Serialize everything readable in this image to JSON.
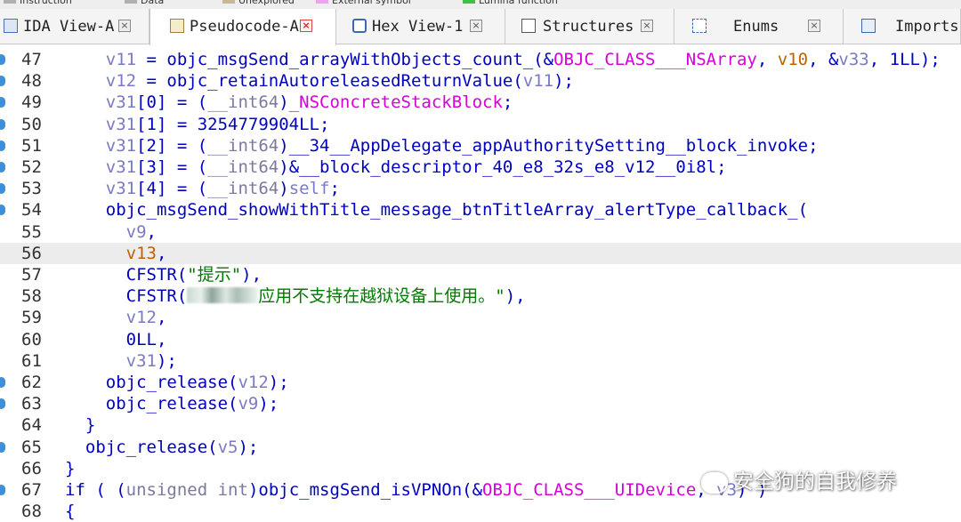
{
  "legend": [
    {
      "label": "Instruction",
      "color": "#b0b0b0"
    },
    {
      "label": "Data",
      "color": "#b0b0b0"
    },
    {
      "label": "Unexplored",
      "color": "#c8b890"
    },
    {
      "label": "External symbol",
      "color": "#f0a0f0"
    },
    {
      "label": "Lumina function",
      "color": "#40c040"
    }
  ],
  "tabs": [
    {
      "label": "IDA View-A",
      "icon": "graph-view-icon",
      "active": false
    },
    {
      "label": "Pseudocode-A",
      "icon": "pseudocode-icon",
      "active": true
    },
    {
      "label": "Hex View-1",
      "icon": "hex-view-icon",
      "active": false
    },
    {
      "label": "Structures",
      "icon": "structures-icon",
      "active": false
    },
    {
      "label": "Enums",
      "icon": "enums-icon",
      "active": false
    },
    {
      "label": "Imports",
      "icon": "imports-icon",
      "active": false
    }
  ],
  "code_lines": [
    {
      "num": "47",
      "bp": true,
      "hl": false,
      "tokens": [
        [
          "pl",
          "    "
        ],
        [
          "var",
          "v11"
        ],
        [
          "pl",
          " = objc_msgSend_arrayWithObjects_count_(&"
        ],
        [
          "mag",
          "OBJC_CLASS___NSArray"
        ],
        [
          "pl",
          ", "
        ],
        [
          "or",
          "v10"
        ],
        [
          "pl",
          ", &"
        ],
        [
          "var",
          "v33"
        ],
        [
          "pl",
          ", 1LL);"
        ]
      ]
    },
    {
      "num": "48",
      "bp": true,
      "hl": false,
      "tokens": [
        [
          "pl",
          "    "
        ],
        [
          "var",
          "v12"
        ],
        [
          "pl",
          " = objc_retainAutoreleasedReturnValue("
        ],
        [
          "var",
          "v11"
        ],
        [
          "pl",
          ");"
        ]
      ]
    },
    {
      "num": "49",
      "bp": true,
      "hl": false,
      "tokens": [
        [
          "pl",
          "    "
        ],
        [
          "var",
          "v31"
        ],
        [
          "pl",
          "[0] = ("
        ],
        [
          "gr",
          "__int64"
        ],
        [
          "pl",
          ")"
        ],
        [
          "mag",
          "_NSConcreteStackBlock"
        ],
        [
          "pl",
          ";"
        ]
      ]
    },
    {
      "num": "50",
      "bp": true,
      "hl": false,
      "tokens": [
        [
          "pl",
          "    "
        ],
        [
          "var",
          "v31"
        ],
        [
          "pl",
          "[1] = 3254779904LL;"
        ]
      ]
    },
    {
      "num": "51",
      "bp": true,
      "hl": false,
      "tokens": [
        [
          "pl",
          "    "
        ],
        [
          "var",
          "v31"
        ],
        [
          "pl",
          "[2] = ("
        ],
        [
          "gr",
          "__int64"
        ],
        [
          "pl",
          ")__34__AppDelegate_appAuthoritySetting__block_invoke;"
        ]
      ]
    },
    {
      "num": "52",
      "bp": true,
      "hl": false,
      "tokens": [
        [
          "pl",
          "    "
        ],
        [
          "var",
          "v31"
        ],
        [
          "pl",
          "[3] = ("
        ],
        [
          "gr",
          "__int64"
        ],
        [
          "pl",
          ")&__block_descriptor_40_e8_32s_e8_v12__0i8l;"
        ]
      ]
    },
    {
      "num": "53",
      "bp": true,
      "hl": false,
      "tokens": [
        [
          "pl",
          "    "
        ],
        [
          "var",
          "v31"
        ],
        [
          "pl",
          "[4] = ("
        ],
        [
          "gr",
          "__int64"
        ],
        [
          "pl",
          ")"
        ],
        [
          "var",
          "self"
        ],
        [
          "pl",
          ";"
        ]
      ]
    },
    {
      "num": "54",
      "bp": true,
      "hl": false,
      "tokens": [
        [
          "pl",
          "    objc_msgSend_showWithTitle_message_btnTitleArray_alertType_callback_("
        ]
      ]
    },
    {
      "num": "55",
      "bp": false,
      "hl": false,
      "tokens": [
        [
          "pl",
          "      "
        ],
        [
          "var",
          "v9"
        ],
        [
          "pl",
          ","
        ]
      ]
    },
    {
      "num": "56",
      "bp": false,
      "hl": true,
      "tokens": [
        [
          "pl",
          "      "
        ],
        [
          "or",
          "v13"
        ],
        [
          "pl",
          ","
        ]
      ]
    },
    {
      "num": "57",
      "bp": false,
      "hl": false,
      "tokens": [
        [
          "pl",
          "      CFSTR("
        ],
        [
          "str",
          "\"提示\""
        ],
        [
          "pl",
          "),"
        ]
      ]
    },
    {
      "num": "58",
      "bp": false,
      "hl": false,
      "tokens": [
        [
          "pl",
          "      CFSTR("
        ],
        [
          "blur",
          ""
        ],
        [
          "str",
          "应用不支持在越狱设备上使用。\""
        ],
        [
          "pl",
          "),"
        ]
      ]
    },
    {
      "num": "59",
      "bp": false,
      "hl": false,
      "tokens": [
        [
          "pl",
          "      "
        ],
        [
          "var",
          "v12"
        ],
        [
          "pl",
          ","
        ]
      ]
    },
    {
      "num": "60",
      "bp": false,
      "hl": false,
      "tokens": [
        [
          "pl",
          "      0LL,"
        ]
      ]
    },
    {
      "num": "61",
      "bp": false,
      "hl": false,
      "tokens": [
        [
          "pl",
          "      "
        ],
        [
          "var",
          "v31"
        ],
        [
          "pl",
          ");"
        ]
      ]
    },
    {
      "num": "62",
      "bp": true,
      "hl": false,
      "tokens": [
        [
          "pl",
          "    objc_release("
        ],
        [
          "var",
          "v12"
        ],
        [
          "pl",
          ");"
        ]
      ]
    },
    {
      "num": "63",
      "bp": true,
      "hl": false,
      "tokens": [
        [
          "pl",
          "    objc_release("
        ],
        [
          "var",
          "v9"
        ],
        [
          "pl",
          ");"
        ]
      ]
    },
    {
      "num": "64",
      "bp": false,
      "hl": false,
      "tokens": [
        [
          "pl",
          "  }"
        ]
      ]
    },
    {
      "num": "65",
      "bp": true,
      "hl": false,
      "tokens": [
        [
          "pl",
          "  objc_release("
        ],
        [
          "var",
          "v5"
        ],
        [
          "pl",
          ");"
        ]
      ]
    },
    {
      "num": "66",
      "bp": false,
      "hl": false,
      "tokens": [
        [
          "pl",
          "}"
        ]
      ]
    },
    {
      "num": "67",
      "bp": true,
      "hl": false,
      "tokens": [
        [
          "kw",
          "if"
        ],
        [
          "pl",
          " ( ("
        ],
        [
          "gr",
          "unsigned int"
        ],
        [
          "pl",
          ")objc_msgSend_isVPNOn(&"
        ],
        [
          "mag",
          "OBJC_CLASS___UIDevice"
        ],
        [
          "pl",
          ", "
        ],
        [
          "var",
          "v3"
        ],
        [
          "pl",
          ") )"
        ]
      ]
    },
    {
      "num": "68",
      "bp": false,
      "hl": false,
      "tokens": [
        [
          "pl",
          "{"
        ]
      ]
    }
  ],
  "watermark": {
    "text": "安全狗的自我修养",
    "icon": "wechat-icon"
  },
  "colors": {
    "code_blue": "#0000c0",
    "variable": "#7a7ac6",
    "imported_symbol": "#d600d6",
    "string": "#007a00",
    "highlight_line": "#ececec",
    "breakpoint_dot": "#3f8fd6"
  }
}
